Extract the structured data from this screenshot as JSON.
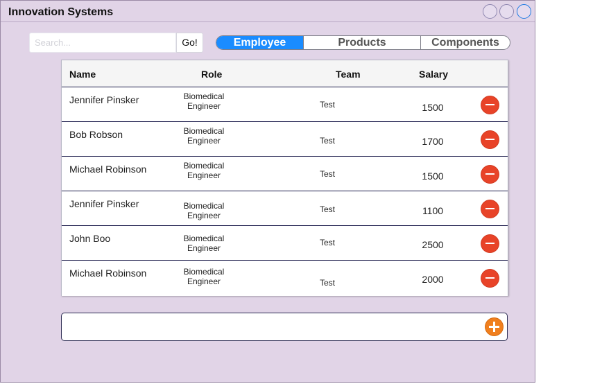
{
  "window": {
    "title": "Innovation Systems"
  },
  "search": {
    "placeholder": "Search...",
    "value": "",
    "go_label": "Go!"
  },
  "tabs": [
    {
      "label": "Employee",
      "active": true
    },
    {
      "label": "Products",
      "active": false
    },
    {
      "label": "Components",
      "active": false
    }
  ],
  "table": {
    "headers": {
      "name": "Name",
      "role": "Role",
      "team": "Team",
      "salary": "Salary"
    },
    "rows": [
      {
        "name": "Jennifer Pinsker",
        "role_line1": "Biomedical",
        "role_line2": "Engineer",
        "team": "Test",
        "salary": "1500"
      },
      {
        "name": "Bob Robson",
        "role_line1": "Biomedical",
        "role_line2": "Engineer",
        "team": "Test",
        "salary": "1700"
      },
      {
        "name": "Michael Robinson",
        "role_line1": "Biomedical",
        "role_line2": "Engineer",
        "team": "Test",
        "salary": "1500"
      },
      {
        "name": "Jennifer Pinsker",
        "role_line1": "Biomedical",
        "role_line2": "Engineer",
        "team": "Test",
        "salary": "1100"
      },
      {
        "name": "John Boo",
        "role_line1": "Biomedical",
        "role_line2": "Engineer",
        "team": "Test",
        "salary": "2500"
      },
      {
        "name": "Michael Robinson",
        "role_line1": "Biomedical",
        "role_line2": "Engineer",
        "team": "Test",
        "salary": "2000"
      }
    ]
  },
  "icons": {
    "window_controls": [
      "window-control-icon",
      "window-control-icon",
      "window-control-icon"
    ],
    "row_action": "remove-circle-icon",
    "add_action": "add-circle-icon"
  },
  "colors": {
    "background": "#e1d4e7",
    "active_tab": "#1a8cff",
    "delete": "#e84328",
    "add": "#f07f1e"
  }
}
